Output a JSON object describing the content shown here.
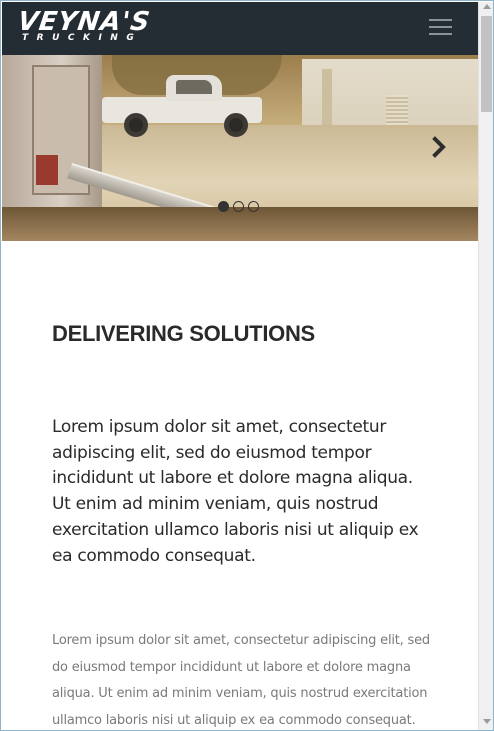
{
  "brand": {
    "name": "VEYNA'S",
    "tagline": "TRUCKING"
  },
  "nav": {
    "menu_icon": "hamburger-menu-icon"
  },
  "carousel": {
    "next_icon": "chevron-right-icon",
    "slides": 3,
    "active_index": 0
  },
  "content": {
    "heading": "DELIVERING SOLUTIONS",
    "lead": "Lorem ipsum dolor sit amet, consectetur adipiscing elit, sed do eiusmod tempor incididunt ut labore et dolore magna aliqua. Ut enim ad minim veniam, quis nostrud exercitation ullamco laboris nisi ut aliquip ex ea commodo consequat.",
    "body": "Lorem ipsum dolor sit amet, consectetur adipiscing elit, sed do eiusmod tempor incididunt ut labore et dolore magna aliqua. Ut enim ad minim veniam, quis nostrud exercitation ullamco laboris nisi ut aliquip ex ea commodo consequat."
  },
  "colors": {
    "navbar": "#252d34",
    "text_dark": "#2a2a2a",
    "text_muted": "#7a7a7a"
  }
}
